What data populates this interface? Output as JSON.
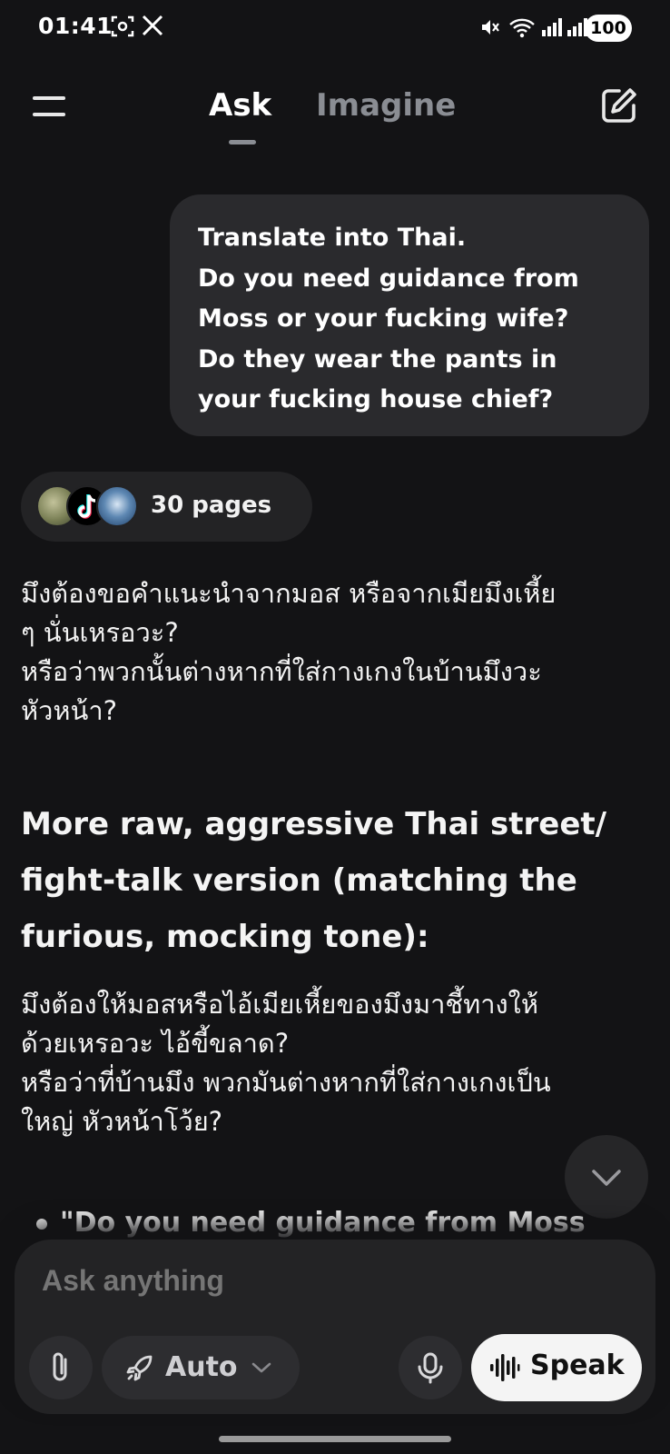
{
  "status_bar": {
    "time": "01:41",
    "battery": "100",
    "icons": [
      "screenshot-icon",
      "x-app-icon",
      "mute-icon",
      "wifi-icon",
      "signal-icon",
      "signal-icon"
    ]
  },
  "nav": {
    "tabs": [
      {
        "label": "Ask",
        "active": true
      },
      {
        "label": "Imagine",
        "active": false
      }
    ],
    "icons": [
      "menu-icon",
      "edit-icon"
    ]
  },
  "user_message": {
    "lines": [
      "Translate into Thai.",
      "Do you need guidance from",
      "Moss or your fucking wife?",
      "Do they wear the pants in",
      "your fucking house chief?"
    ]
  },
  "sources": {
    "label": "30 pages"
  },
  "response": {
    "paragraph_1": [
      "มึงต้องขอคำแนะนำจากมอส หรือจากเมียมึงเหี้ย",
      "ๆ นั่นเหรอวะ?",
      "หรือว่าพวกนั้นต่างหากที่ใส่กางเกงในบ้านมึงวะ",
      "หัวหน้า?"
    ],
    "heading": [
      "More raw, aggressive Thai street/",
      "fight-talk version (matching the",
      "furious, mocking tone):"
    ],
    "paragraph_2": [
      "มึงต้องให้มอสหรือไอ้เมียเหี้ยของมึงมาชี้ทางให้",
      "ด้วยเหรอวะ ไอ้ขี้ขลาด?",
      "หรือว่าที่บ้านมึง พวกมันต่างหากที่ใส่กางเกงเป็น",
      "ใหญ่ หัวหน้าโว้ย?"
    ],
    "bullet_1": "\"Do you need guidance from Moss"
  },
  "composer": {
    "placeholder": "Ask anything",
    "mode_label": "Auto",
    "speak_label": "Speak"
  },
  "colors": {
    "background": "#131315",
    "bubble": "#2a2a2d",
    "inactive_tab": "#8a8d93",
    "speak_button": "#f4f4f4"
  }
}
